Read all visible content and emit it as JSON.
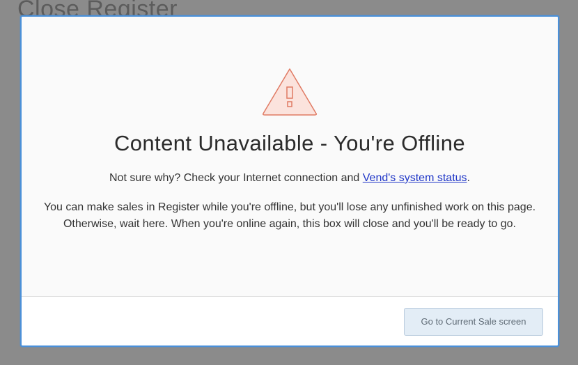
{
  "background": {
    "page_title": "Close Register"
  },
  "modal": {
    "icon": "warning-triangle-icon",
    "title": "Content Unavailable - You're Offline",
    "subline_prefix": "Not sure why? Check your Internet connection and ",
    "status_link": "Vend's system status",
    "subline_suffix": ".",
    "paragraph": "You can make sales in Register while you're offline, but you'll lose any unfinished work on this page. Otherwise, wait here. When you're online again, this box will close and you'll be ready to go.",
    "button_label": "Go to Current Sale screen"
  },
  "colors": {
    "overlay": "#8b8b8b",
    "modal_border": "#4a90d9",
    "warning_stroke": "#e07a63",
    "warning_fill": "#fbe3dd",
    "link": "#1f36c7",
    "button_bg": "#e3edf6"
  }
}
